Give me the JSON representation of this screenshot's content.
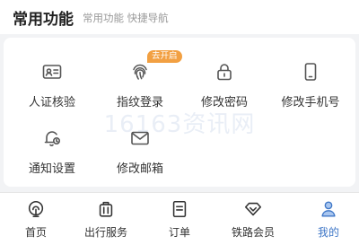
{
  "header": {
    "title": "常用功能",
    "subtitle": "常用功能 快捷导航"
  },
  "functions": [
    {
      "label": "人证核验",
      "icon": "id-card-icon"
    },
    {
      "label": "指纹登录",
      "icon": "fingerprint-icon",
      "badge": "去开启"
    },
    {
      "label": "修改密码",
      "icon": "lock-icon"
    },
    {
      "label": "修改手机号",
      "icon": "phone-icon"
    },
    {
      "label": "通知设置",
      "icon": "bell-icon"
    },
    {
      "label": "修改邮箱",
      "icon": "mail-icon"
    }
  ],
  "watermark": "16163资讯网",
  "tabbar": {
    "active": "我的",
    "tabs": [
      {
        "label": "首页",
        "icon": "railway-logo-icon"
      },
      {
        "label": "出行服务",
        "icon": "luggage-icon"
      },
      {
        "label": "订单",
        "icon": "order-list-icon"
      },
      {
        "label": "铁路会员",
        "icon": "diamond-icon"
      },
      {
        "label": "我的",
        "icon": "user-icon"
      }
    ]
  },
  "colors": {
    "accent": "#3f77c7",
    "badge": "#f2a042",
    "icon": "#555555"
  }
}
